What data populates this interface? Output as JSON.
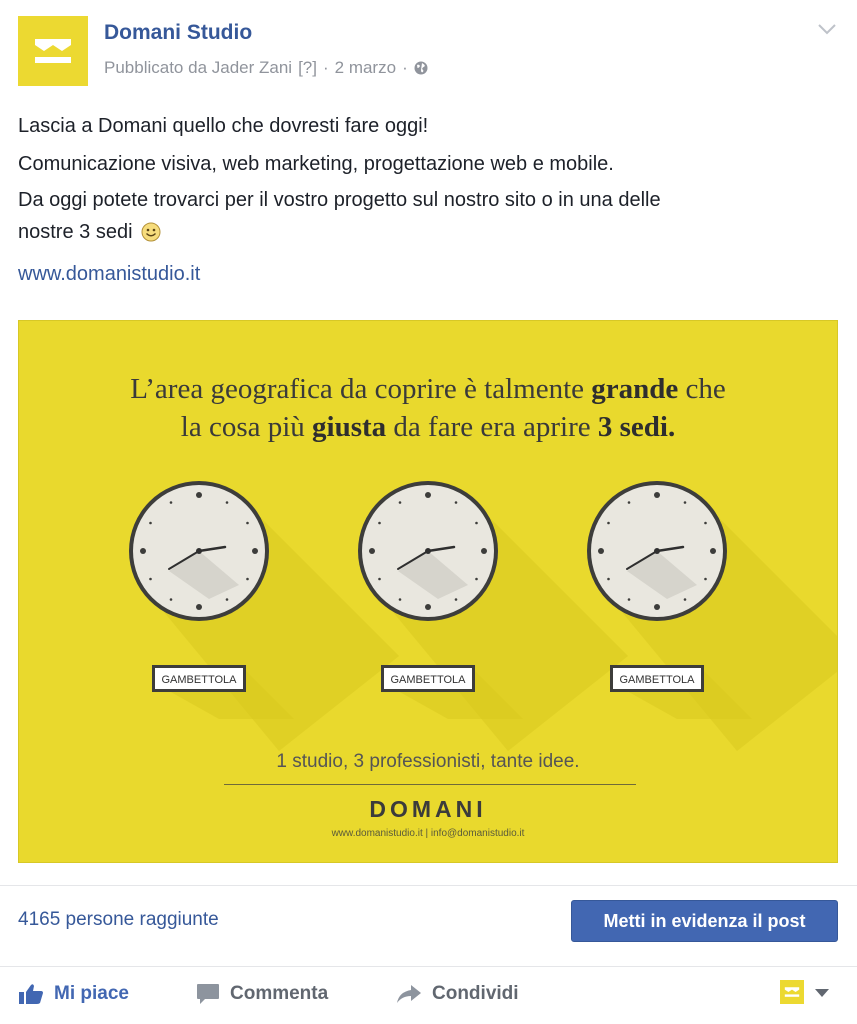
{
  "header": {
    "page_name": "Domani Studio",
    "published_by": "Pubblicato da Jader Zani",
    "help_marker": "[?]",
    "date": "2 marzo",
    "separator": "·",
    "audience_icon": "globe-icon",
    "menu_icon": "chevron-down-icon"
  },
  "post": {
    "line1": "Lascia a Domani quello che dovresti fare oggi!",
    "line2": "Comunicazione visiva, web marketing, progettazione web e mobile.",
    "line3": "Da oggi potete trovarci per il vostro progetto sul nostro sito o in una delle",
    "line4": "nostre 3 sedi",
    "emoji": "smiley-emoji",
    "link": "www.domanistudio.it"
  },
  "image": {
    "background": "#e9d92d",
    "headline1_a": "L’area geografica da coprire è talmente ",
    "headline1_b": "grande",
    "headline1_c": " che",
    "headline2_a": "la cosa più ",
    "headline2_b": "giusta",
    "headline2_c": " da fare era aprire ",
    "headline2_d": "3 sedi.",
    "clock_labels": [
      "GAMBETTOLA",
      "GAMBETTOLA",
      "GAMBETTOLA"
    ],
    "tagline": "1 studio, 3 professionisti, tante idee.",
    "brand": "DOMANI",
    "contact": "www.domanistudio.it | info@domanistudio.it"
  },
  "stats": {
    "reach": "4165 persone raggiunte",
    "boost_button": "Metti in evidenza il post",
    "accent": "#4267b2"
  },
  "actions": {
    "like": "Mi piace",
    "comment": "Commenta",
    "share": "Condividi",
    "like_icon": "thumbs-up-icon",
    "comment_icon": "comment-icon",
    "share_icon": "share-arrow-icon"
  }
}
